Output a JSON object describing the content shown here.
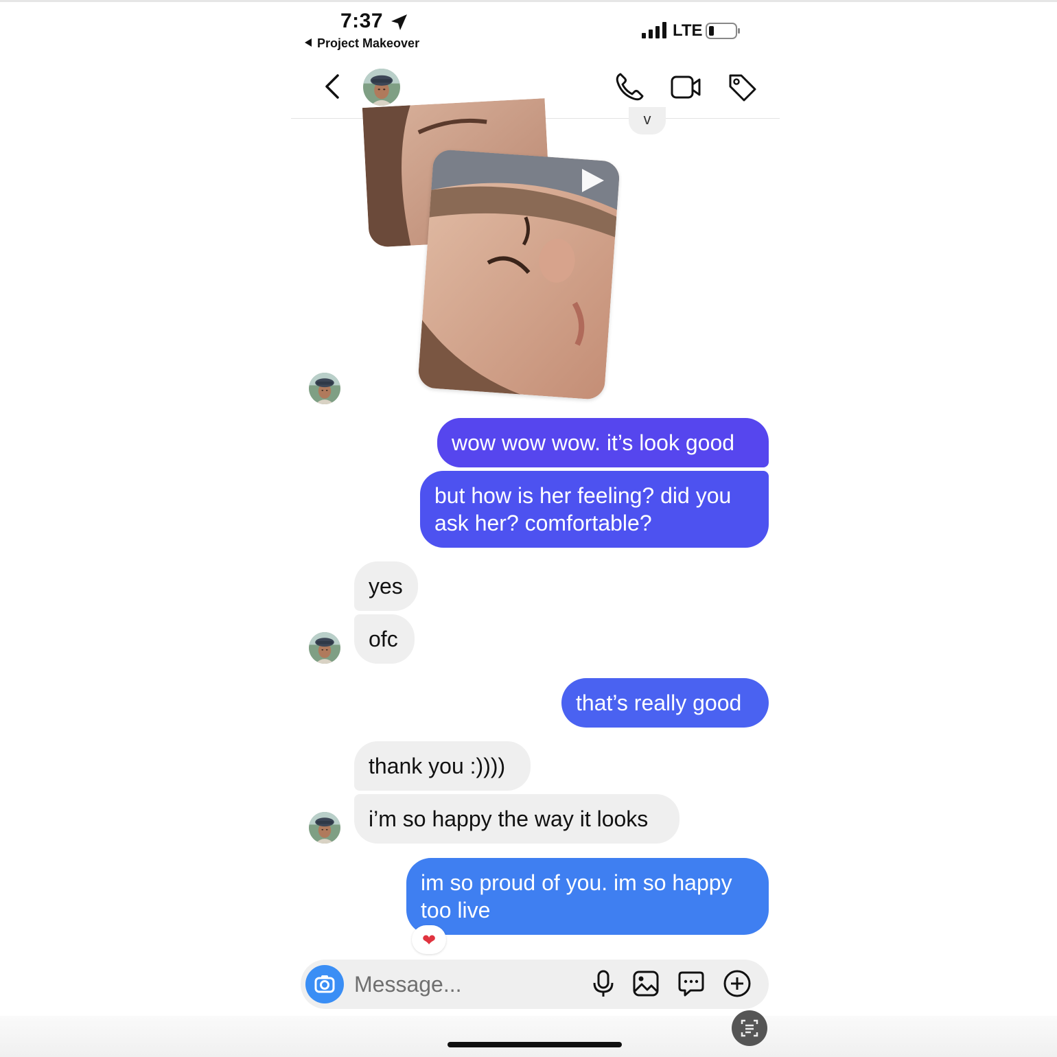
{
  "status_bar": {
    "time": "7:37",
    "back_app": "Project Makeover",
    "network": "LTE"
  },
  "header": {
    "icons": [
      "back-chevron-icon",
      "phone-icon",
      "video-camera-icon",
      "tag-icon"
    ]
  },
  "thread": {
    "reply_indicator": "v",
    "messages": [
      {
        "from": "me",
        "text": "wow wow wow. it’s look good"
      },
      {
        "from": "me",
        "text": "but how is her feeling? did you ask her? comfortable?"
      },
      {
        "from": "them",
        "text": "yes"
      },
      {
        "from": "them",
        "text": "ofc"
      },
      {
        "from": "me",
        "text": "that’s really good"
      },
      {
        "from": "them",
        "text": "thank you :))))"
      },
      {
        "from": "them",
        "text": "i’m so happy the way it looks"
      },
      {
        "from": "me",
        "text": "im so proud of you. im so happy too live",
        "reaction": "heart"
      }
    ]
  },
  "composer": {
    "placeholder": "Message...",
    "icons": [
      "camera-icon",
      "microphone-icon",
      "gallery-icon",
      "sticker-icon",
      "plus-icon"
    ]
  },
  "colors": {
    "bubble_out_top": "#5b47ee",
    "bubble_out_bottom": "#3f7ff1",
    "bubble_in": "#efefef",
    "reaction": "#e0333f"
  }
}
